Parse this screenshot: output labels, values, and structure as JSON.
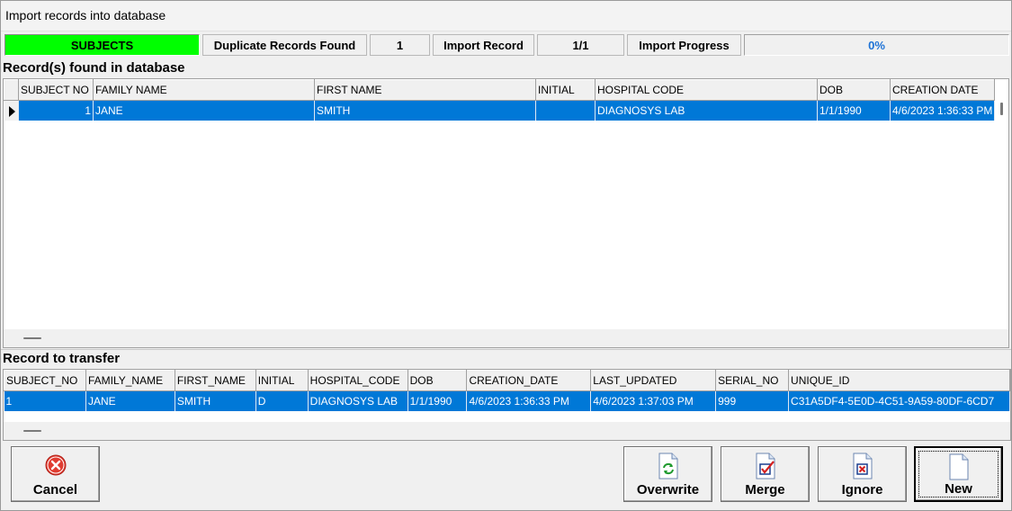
{
  "window": {
    "title": "Import records into database"
  },
  "status_bar": {
    "module": "SUBJECTS",
    "duplicate_label": "Duplicate Records Found",
    "duplicate_count": "1",
    "import_record_label": "Import Record",
    "import_record_value": "1/1",
    "import_progress_label": "Import Progress",
    "import_progress_value": "0%",
    "progress_fraction": 0.0
  },
  "found_section": {
    "label": "Record(s) found in database",
    "columns": [
      "SUBJECT NO",
      "FAMILY NAME",
      "FIRST NAME",
      "INITIAL",
      "HOSPITAL CODE",
      "DOB",
      "CREATION DATE"
    ],
    "rows": [
      [
        "1",
        "JANE",
        "SMITH",
        "",
        "DIAGNOSYS LAB",
        "1/1/1990",
        "4/6/2023 1:36:33 PM"
      ]
    ]
  },
  "transfer_section": {
    "label": "Record to transfer",
    "columns": [
      "SUBJECT_NO",
      "FAMILY_NAME",
      "FIRST_NAME",
      "INITIAL",
      "HOSPITAL_CODE",
      "DOB",
      "CREATION_DATE",
      "LAST_UPDATED",
      "SERIAL_NO",
      "UNIQUE_ID"
    ],
    "rows": [
      [
        "1",
        "JANE",
        "SMITH",
        "D",
        "DIAGNOSYS LAB",
        "1/1/1990",
        "4/6/2023 1:36:33 PM",
        "4/6/2023 1:37:03 PM",
        "999",
        "C31A5DF4-5E0D-4C51-9A59-80DF-6CD7"
      ]
    ]
  },
  "buttons": {
    "cancel": "Cancel",
    "overwrite": "Overwrite",
    "merge": "Merge",
    "ignore": "Ignore",
    "new": "New"
  },
  "colors": {
    "module_green": "#00ff00",
    "selection_blue": "#0078d7",
    "progress_text": "#1e73d6",
    "cancel_red": "#e03c31"
  }
}
